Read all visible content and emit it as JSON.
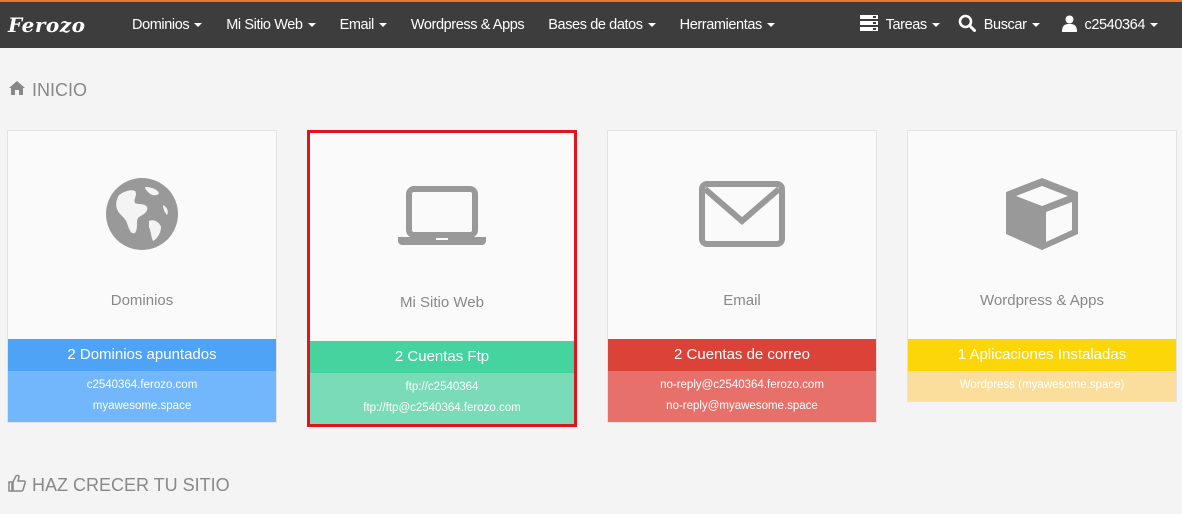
{
  "nav": {
    "brand": "Ferozo",
    "items": [
      {
        "label": "Dominios",
        "dropdown": true
      },
      {
        "label": "Mi Sitio Web",
        "dropdown": true
      },
      {
        "label": "Email",
        "dropdown": true
      },
      {
        "label": "Wordpress & Apps",
        "dropdown": false
      },
      {
        "label": "Bases de datos",
        "dropdown": true
      },
      {
        "label": "Herramientas",
        "dropdown": true
      }
    ],
    "tasks_label": "Tareas",
    "search_label": "Buscar",
    "user_label": "c2540364"
  },
  "home": {
    "title": "INICIO",
    "icon": "home-icon"
  },
  "cards": [
    {
      "label": "Dominios",
      "icon": "globe-icon",
      "strip": "2 Dominios apuntados",
      "details": [
        "c2540364.ferozo.com",
        "myawesome.space"
      ],
      "color": "#4fa3f7"
    },
    {
      "label": "Mi Sitio Web",
      "icon": "laptop-icon",
      "strip": "2 Cuentas Ftp",
      "details": [
        "ftp://c2540364",
        "ftp://ftp@c2540364.ferozo.com"
      ],
      "color": "#45d3a0",
      "highlighted": true
    },
    {
      "label": "Email",
      "icon": "envelope-icon",
      "strip": "2 Cuentas de correo",
      "details": [
        "no-reply@c2540364.ferozo.com",
        "no-reply@myawesome.space"
      ],
      "color": "#db4338"
    },
    {
      "label": "Wordpress & Apps",
      "icon": "cube-icon",
      "strip": "1 Aplicaciones Instaladas",
      "details": [
        "Wordpress (myawesome.space)"
      ],
      "color": "#fdd60a"
    }
  ],
  "grow": {
    "title": "HAZ CRECER TU SITIO",
    "icon": "thumbs-up-icon"
  }
}
